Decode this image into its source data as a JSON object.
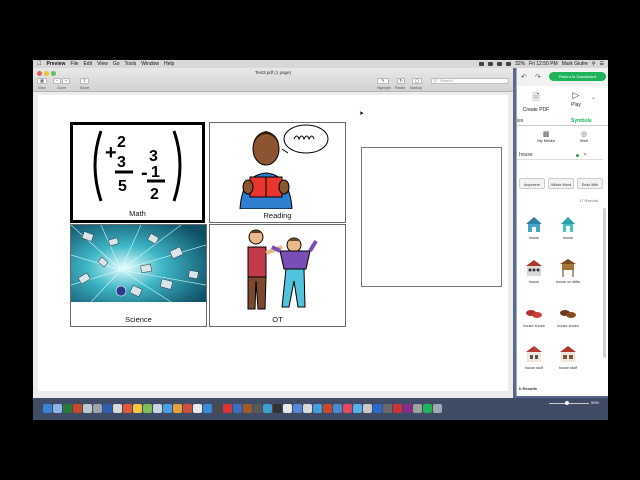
{
  "menubar": {
    "app": "Preview",
    "items": [
      "File",
      "Edit",
      "View",
      "Go",
      "Tools",
      "Window",
      "Help"
    ],
    "clock": "Fri 12:50 PM",
    "user": "Mark Giufre",
    "battery": "32%"
  },
  "preview": {
    "title": "Test3.pdf (1 page)",
    "toolbar": {
      "view": "View",
      "zoom": "Zoom",
      "share": "Share",
      "highlight": "Highlight",
      "rotate": "Rotate",
      "markup": "Markup",
      "search_placeholder": "Search"
    },
    "cells": [
      {
        "label": "Math"
      },
      {
        "label": "Reading"
      },
      {
        "label": "Science"
      },
      {
        "label": "OT"
      }
    ]
  },
  "panel": {
    "dashboard_button": "Return to Dashboard",
    "actions": {
      "create_pdf": "Create PDF",
      "play": "Play"
    },
    "tabs": {
      "left": "ies",
      "symbols": "Symbols"
    },
    "sources": {
      "my_media": "My Media",
      "web": "Web"
    },
    "search_value": "house",
    "options": [
      "Anywhere",
      "Whole Word",
      "Ends With"
    ],
    "results_count": "17 Results",
    "results": [
      {
        "label": "house"
      },
      {
        "label": "house"
      },
      {
        "label": "house"
      },
      {
        "label": "house on stilts"
      },
      {
        "label": "house shoes"
      },
      {
        "label": "house shoes"
      },
      {
        "label": "house stuff"
      },
      {
        "label": "house stuff"
      }
    ],
    "more_results": "h Results"
  },
  "status": {
    "zoom": "90%"
  },
  "colors": {
    "accent_green": "#1fb35a",
    "symbols_tab": "#1fb35a"
  }
}
